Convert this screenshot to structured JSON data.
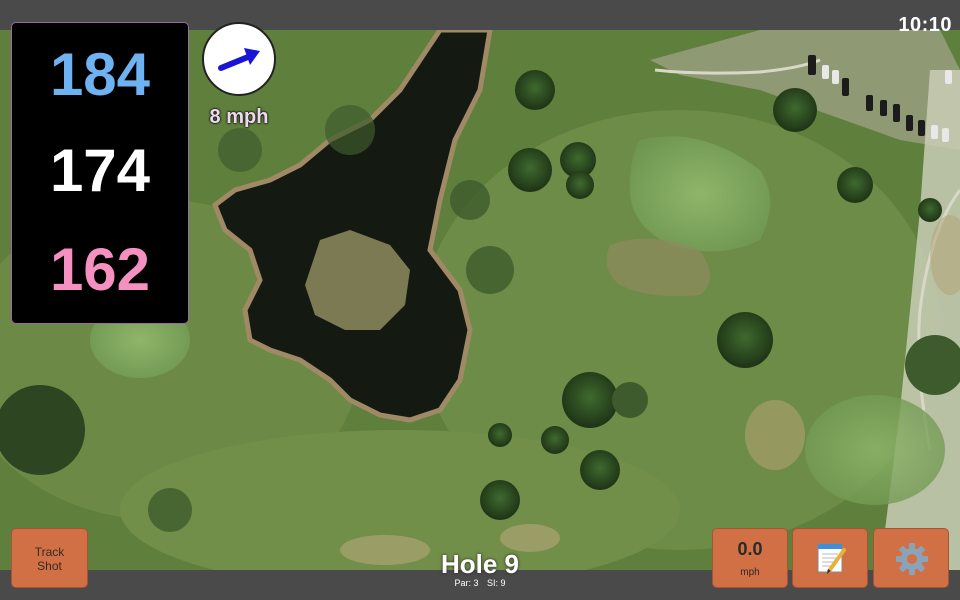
{
  "status": {
    "time": "10:10"
  },
  "distances": {
    "back": "184",
    "middle": "174",
    "front": "162"
  },
  "wind": {
    "speed": "8 mph",
    "direction": "north-east"
  },
  "hole": {
    "title": "Hole 9",
    "par_label": "Par: 3",
    "si_label": "SI: 9"
  },
  "buttons": {
    "track_shot_line1": "Track",
    "track_shot_line2": "Shot",
    "speed_value": "0.0",
    "speed_unit": "mph",
    "notes_icon": "notepad-icon",
    "settings_icon": "gear-icon"
  },
  "colors": {
    "back_distance": "#6fb2f2",
    "middle_distance": "#ffffff",
    "front_distance": "#f491c0",
    "button_accent": "#d16f45"
  }
}
